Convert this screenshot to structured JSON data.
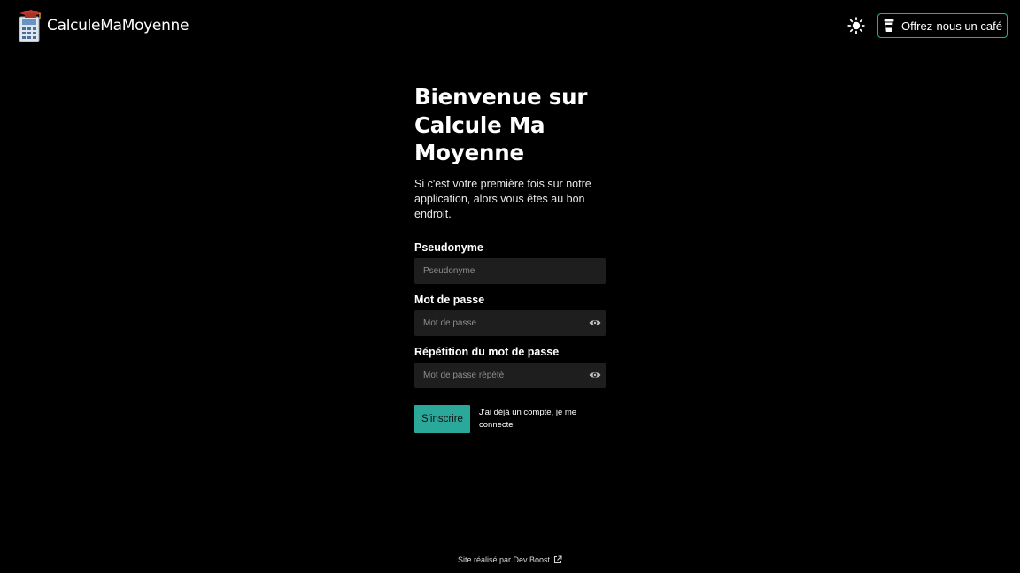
{
  "header": {
    "brand_name": "CalculeMaMoyenne",
    "coffee_label": "Offrez-nous un café",
    "icons": {
      "logo": "calculator-graduation-cap-icon",
      "theme_toggle": "sun-icon",
      "coffee": "coffee-cup-icon"
    }
  },
  "main": {
    "title": "Bienvenue sur Calcule Ma Moyenne",
    "intro": "Si c'est votre première fois sur notre application, alors vous êtes au bon endroit.",
    "fields": {
      "pseudonym": {
        "label": "Pseudonyme",
        "placeholder": "Pseudonyme",
        "value": ""
      },
      "password": {
        "label": "Mot de passe",
        "placeholder": "Mot de passe",
        "value": ""
      },
      "password_repeat": {
        "label": "Répétition du mot de passe",
        "placeholder": "Mot de passe répété",
        "value": ""
      }
    },
    "submit_label": "S'inscrire",
    "login_link": "J'ai déjà un compte, je me connecte"
  },
  "footer": {
    "credit": "Site réalisé par Dev Boost",
    "icon": "external-link-icon"
  },
  "colors": {
    "background": "#000000",
    "accent": "#2aa89a",
    "input_background": "#1e1e1e",
    "text": "#ffffff"
  }
}
